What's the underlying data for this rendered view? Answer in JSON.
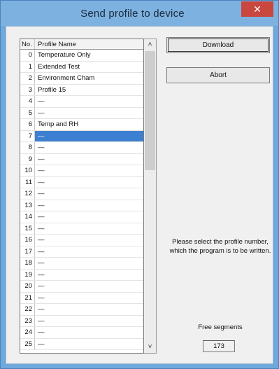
{
  "window": {
    "title": "Send profile to device",
    "close_glyph": "✕"
  },
  "list": {
    "col_no": "No.",
    "col_name": "Profile Name",
    "selected_index": 7,
    "rows": [
      {
        "no": "0",
        "name": "Temperature Only"
      },
      {
        "no": "1",
        "name": "Extended Test"
      },
      {
        "no": "2",
        "name": "Environment Cham"
      },
      {
        "no": "3",
        "name": "Profile 15"
      },
      {
        "no": "4",
        "name": "—"
      },
      {
        "no": "5",
        "name": "—"
      },
      {
        "no": "6",
        "name": "Temp and RH"
      },
      {
        "no": "7",
        "name": "—"
      },
      {
        "no": "8",
        "name": "—"
      },
      {
        "no": "9",
        "name": "—"
      },
      {
        "no": "10",
        "name": "—"
      },
      {
        "no": "11",
        "name": "—"
      },
      {
        "no": "12",
        "name": "—"
      },
      {
        "no": "13",
        "name": "—"
      },
      {
        "no": "14",
        "name": "—"
      },
      {
        "no": "15",
        "name": "—"
      },
      {
        "no": "16",
        "name": "—"
      },
      {
        "no": "17",
        "name": "—"
      },
      {
        "no": "18",
        "name": "—"
      },
      {
        "no": "19",
        "name": "—"
      },
      {
        "no": "20",
        "name": "—"
      },
      {
        "no": "21",
        "name": "—"
      },
      {
        "no": "22",
        "name": "—"
      },
      {
        "no": "23",
        "name": "—"
      },
      {
        "no": "24",
        "name": "—"
      },
      {
        "no": "25",
        "name": "—"
      }
    ]
  },
  "scroll": {
    "up_glyph": "˄",
    "down_glyph": "˅"
  },
  "buttons": {
    "download": "Download",
    "abort": "Abort"
  },
  "message": "Please select the profile number, which the program is to be written.",
  "free_segments": {
    "label": "Free segments",
    "value": "173"
  },
  "colors": {
    "titlebar": "#7db1e0",
    "close": "#c9473f",
    "selection": "#3d7fd0",
    "client": "#f0f0f0"
  }
}
